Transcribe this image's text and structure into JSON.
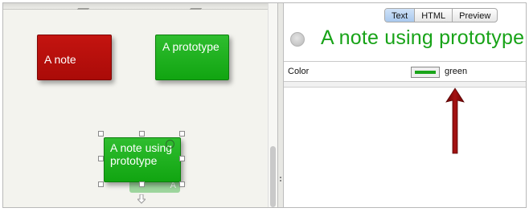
{
  "canvas": {
    "notes": [
      {
        "text": "A note",
        "color": "#b30f0c"
      },
      {
        "text": "A prototype",
        "color": "#17a817"
      },
      {
        "text": "A note using prototype",
        "color": "#17a817"
      }
    ],
    "badge_text": "A"
  },
  "inspector": {
    "view_tabs": [
      "Text",
      "HTML",
      "Preview"
    ],
    "active_tab": "Text",
    "note_title": "A note using prototype",
    "attributes": [
      {
        "name": "Color",
        "value": "green",
        "swatch": "#1aa51a"
      }
    ],
    "annotation": {
      "type": "arrow",
      "color": "#8b0a0a"
    }
  }
}
